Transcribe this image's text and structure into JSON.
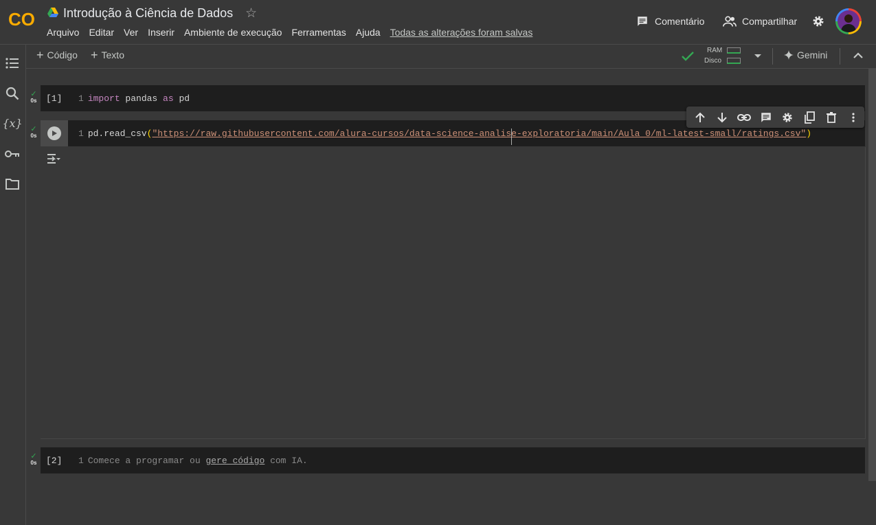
{
  "header": {
    "title": "Introdução à Ciência de Dados",
    "logo_text": "CO",
    "menu": [
      "Arquivo",
      "Editar",
      "Ver",
      "Inserir",
      "Ambiente de execução",
      "Ferramentas",
      "Ajuda"
    ],
    "save_status": "Todas as alterações foram salvas",
    "comment_label": "Comentário",
    "share_label": "Compartilhar"
  },
  "toolbar": {
    "add_code_label": "Código",
    "add_text_label": "Texto",
    "ram_label": "RAM",
    "disk_label": "Disco",
    "gemini_label": "Gemini"
  },
  "cells": [
    {
      "exec_count": "[1]",
      "status_time": "0s",
      "line_number": "1",
      "code": {
        "kw1": "import",
        "mid": " pandas ",
        "kw2": "as",
        "end": " pd"
      }
    },
    {
      "exec_count": "",
      "status_time": "0s",
      "line_number": "1",
      "code": {
        "prefix": "pd.read_csv",
        "open": "(",
        "url": "\"https://raw.githubusercontent.com/alura-cursos/data-science-analise-exploratoria/main/Aula_0/ml-latest-small/ratings.csv\"",
        "close": ")"
      }
    },
    {
      "exec_count": "[2]",
      "status_time": "0s",
      "line_number": "1",
      "placeholder": {
        "before": "Comece a programar ou ",
        "link": "gere código",
        "after": " com IA."
      }
    }
  ],
  "icons": {
    "sidebar": [
      "table-of-contents-icon",
      "search-icon",
      "variables-icon",
      "secrets-key-icon",
      "folder-icon"
    ],
    "cell_toolbar": [
      "move-up-icon",
      "move-down-icon",
      "link-icon",
      "comment-icon",
      "settings-icon",
      "mirror-cell-icon",
      "delete-icon",
      "more-icon"
    ]
  },
  "colors": {
    "accent_orange": "#f9ab00",
    "check_green": "#34a853",
    "keyword": "#c586c0",
    "string": "#ce9178"
  }
}
